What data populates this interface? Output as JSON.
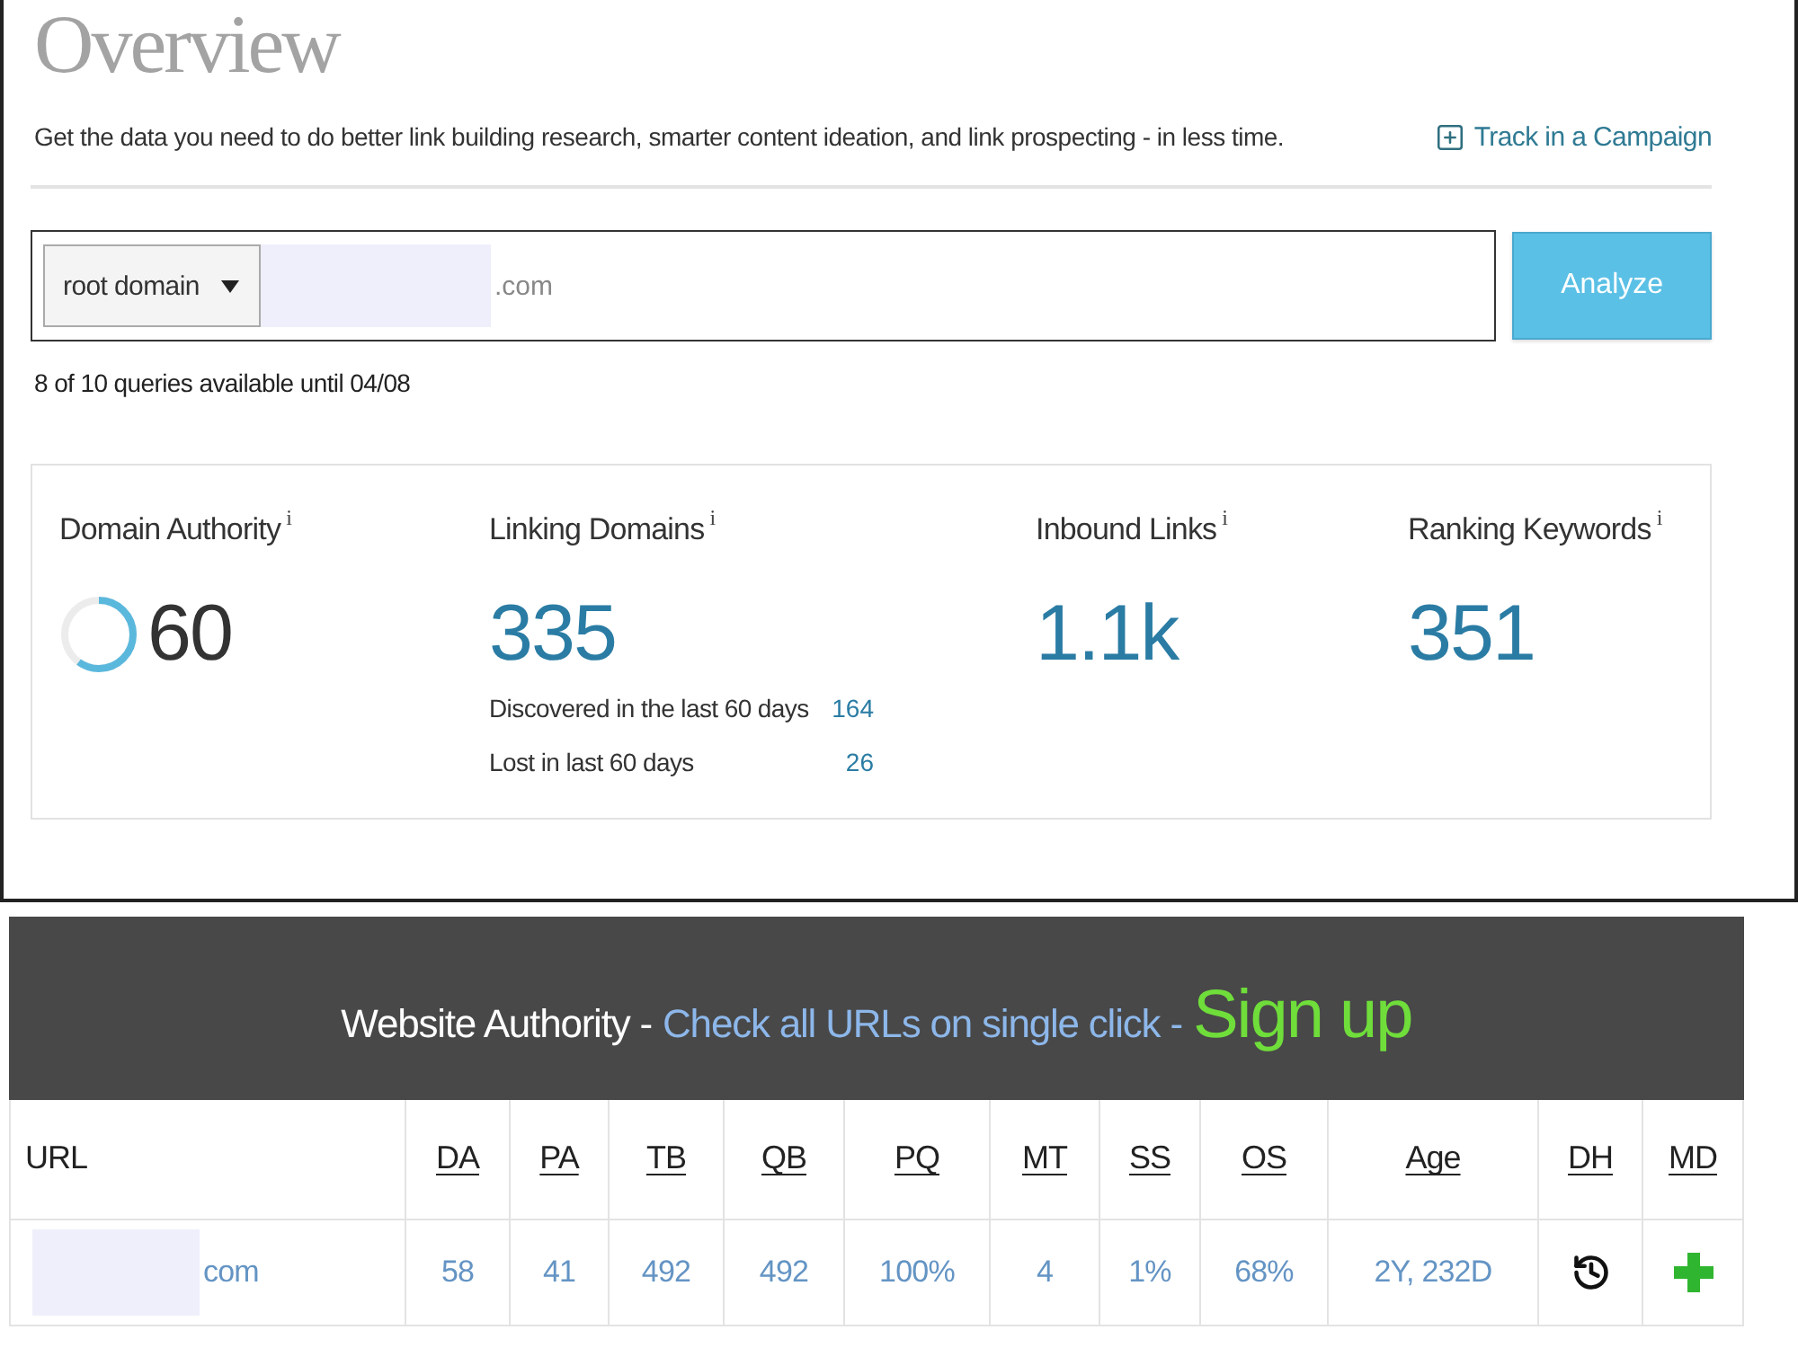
{
  "overview": {
    "title": "Overview",
    "description": "Get the data you need to do better link building research, smarter content ideation, and link prospecting - in less time.",
    "track_link": "Track in a Campaign"
  },
  "search": {
    "scope": "root domain",
    "redacted": true,
    "value": ".com",
    "button": "Analyze",
    "quota": "8 of 10 queries available until 04/08"
  },
  "metrics": [
    {
      "kind": "gauge",
      "label": "Domain Authority",
      "info": "i",
      "value": "60",
      "level": 0.6
    },
    {
      "kind": "count",
      "label": "Linking Domains",
      "info": "i",
      "value": "335",
      "details": [
        {
          "label": "Discovered in the last 60 days",
          "value": "164"
        },
        {
          "label": "Lost in last 60 days",
          "value": "26"
        }
      ]
    },
    {
      "kind": "count",
      "label": "Inbound Links",
      "info": "i",
      "value": "1.1k"
    },
    {
      "kind": "count",
      "label": "Ranking Keywords",
      "info": "i",
      "value": "351"
    }
  ],
  "banner": {
    "title": "Website Authority -",
    "tagline": "Check all URLs on single click -",
    "link": "Sign up"
  },
  "table": {
    "columns": [
      {
        "label": "URL",
        "underlined": false
      },
      {
        "label": "DA",
        "underlined": true
      },
      {
        "label": "PA",
        "underlined": true
      },
      {
        "label": "TB",
        "underlined": true
      },
      {
        "label": "QB",
        "underlined": true
      },
      {
        "label": "PQ",
        "underlined": true
      },
      {
        "label": "MT",
        "underlined": true
      },
      {
        "label": "SS",
        "underlined": true
      },
      {
        "label": "OS",
        "underlined": true
      },
      {
        "label": "Age",
        "underlined": true
      },
      {
        "label": "DH",
        "underlined": true
      },
      {
        "label": "MD",
        "underlined": true
      }
    ],
    "rows": [
      {
        "cells": [
          {
            "kind": "url",
            "redacted": true,
            "text": "com"
          },
          {
            "kind": "text",
            "text": "58"
          },
          {
            "kind": "text",
            "text": "41"
          },
          {
            "kind": "text",
            "text": "492"
          },
          {
            "kind": "text",
            "text": "492"
          },
          {
            "kind": "text",
            "text": "100%"
          },
          {
            "kind": "text",
            "text": "4"
          },
          {
            "kind": "text",
            "text": "1%"
          },
          {
            "kind": "text",
            "text": "68%"
          },
          {
            "kind": "text",
            "text": "2Y, 232D"
          },
          {
            "kind": "history"
          },
          {
            "kind": "add"
          }
        ]
      }
    ]
  }
}
